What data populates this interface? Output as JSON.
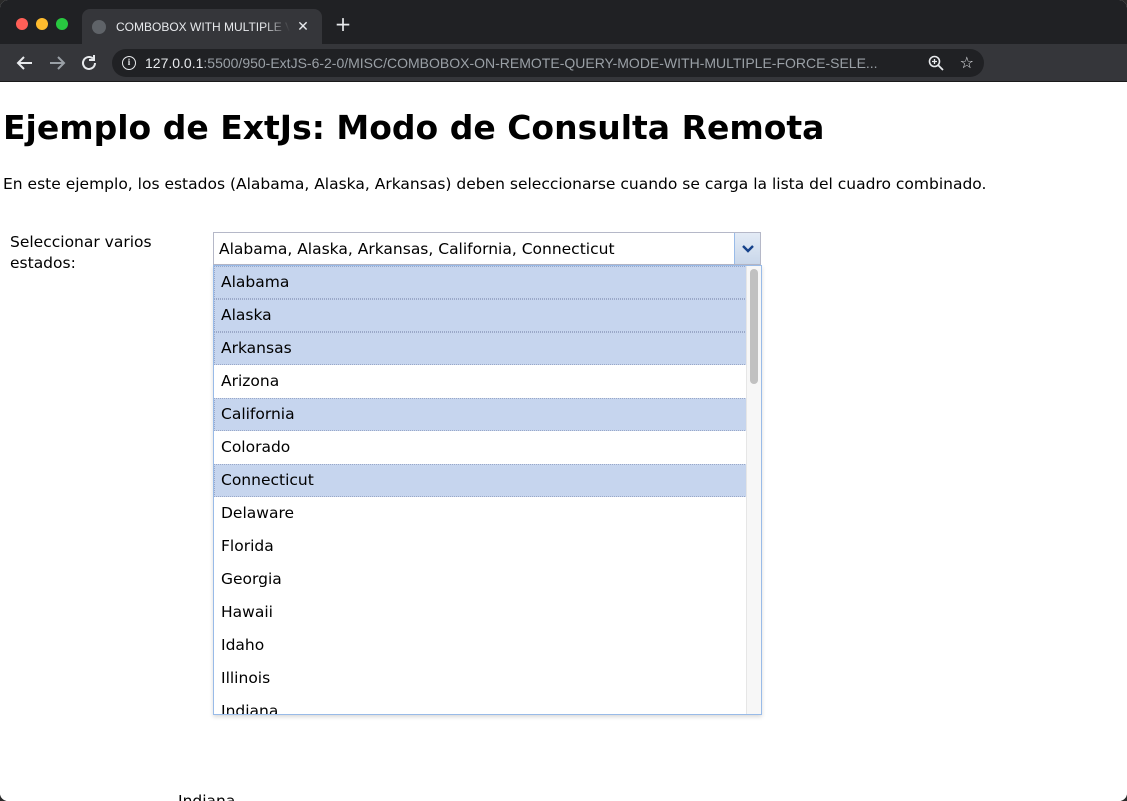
{
  "browser": {
    "tab_title": "COMBOBOX WITH MULTIPLE VALUES",
    "tab_close": "✕",
    "new_tab": "+",
    "url_host": "127.0.0.1",
    "url_rest": ":5500/950-ExtJS-6-2-0/MISC/COMBOBOX-ON-REMOTE-QUERY-MODE-WITH-MULTIPLE-FORCE-SELE...",
    "icons": {
      "back": "arrow-left-icon",
      "forward": "arrow-right-icon",
      "reload": "reload-icon",
      "info": "info-icon",
      "zoom": "zoom-icon",
      "bookmark": "star-icon",
      "extensions": "puzzle-icon",
      "media": "media-control-icon",
      "menu": "kebab-menu-icon"
    }
  },
  "page": {
    "title": "Ejemplo de ExtJs: Modo de Consulta Remota",
    "description": "En este ejemplo, los estados (Alabama, Alaska, Arkansas) deben seleccionarse cuando se carga la lista del cuadro combinado.",
    "field_label": "Seleccionar varios estados:",
    "combo_value": "Alabama, Alaska, Arkansas, California, Connecticut",
    "options": [
      {
        "label": "Alabama",
        "selected": true
      },
      {
        "label": "Alaska",
        "selected": true
      },
      {
        "label": "Arkansas",
        "selected": true
      },
      {
        "label": "Arizona",
        "selected": false
      },
      {
        "label": "California",
        "selected": true
      },
      {
        "label": "Colorado",
        "selected": false
      },
      {
        "label": "Connecticut",
        "selected": true
      },
      {
        "label": "Delaware",
        "selected": false
      },
      {
        "label": "Florida",
        "selected": false
      },
      {
        "label": "Georgia",
        "selected": false
      },
      {
        "label": "Hawaii",
        "selected": false
      },
      {
        "label": "Idaho",
        "selected": false
      },
      {
        "label": "Illinois",
        "selected": false
      },
      {
        "label": "Indiana",
        "selected": false
      }
    ],
    "ghost_text": "Indiana"
  },
  "colors": {
    "selected_row": "#c6d5ee",
    "picker_border": "#99bbe8"
  }
}
